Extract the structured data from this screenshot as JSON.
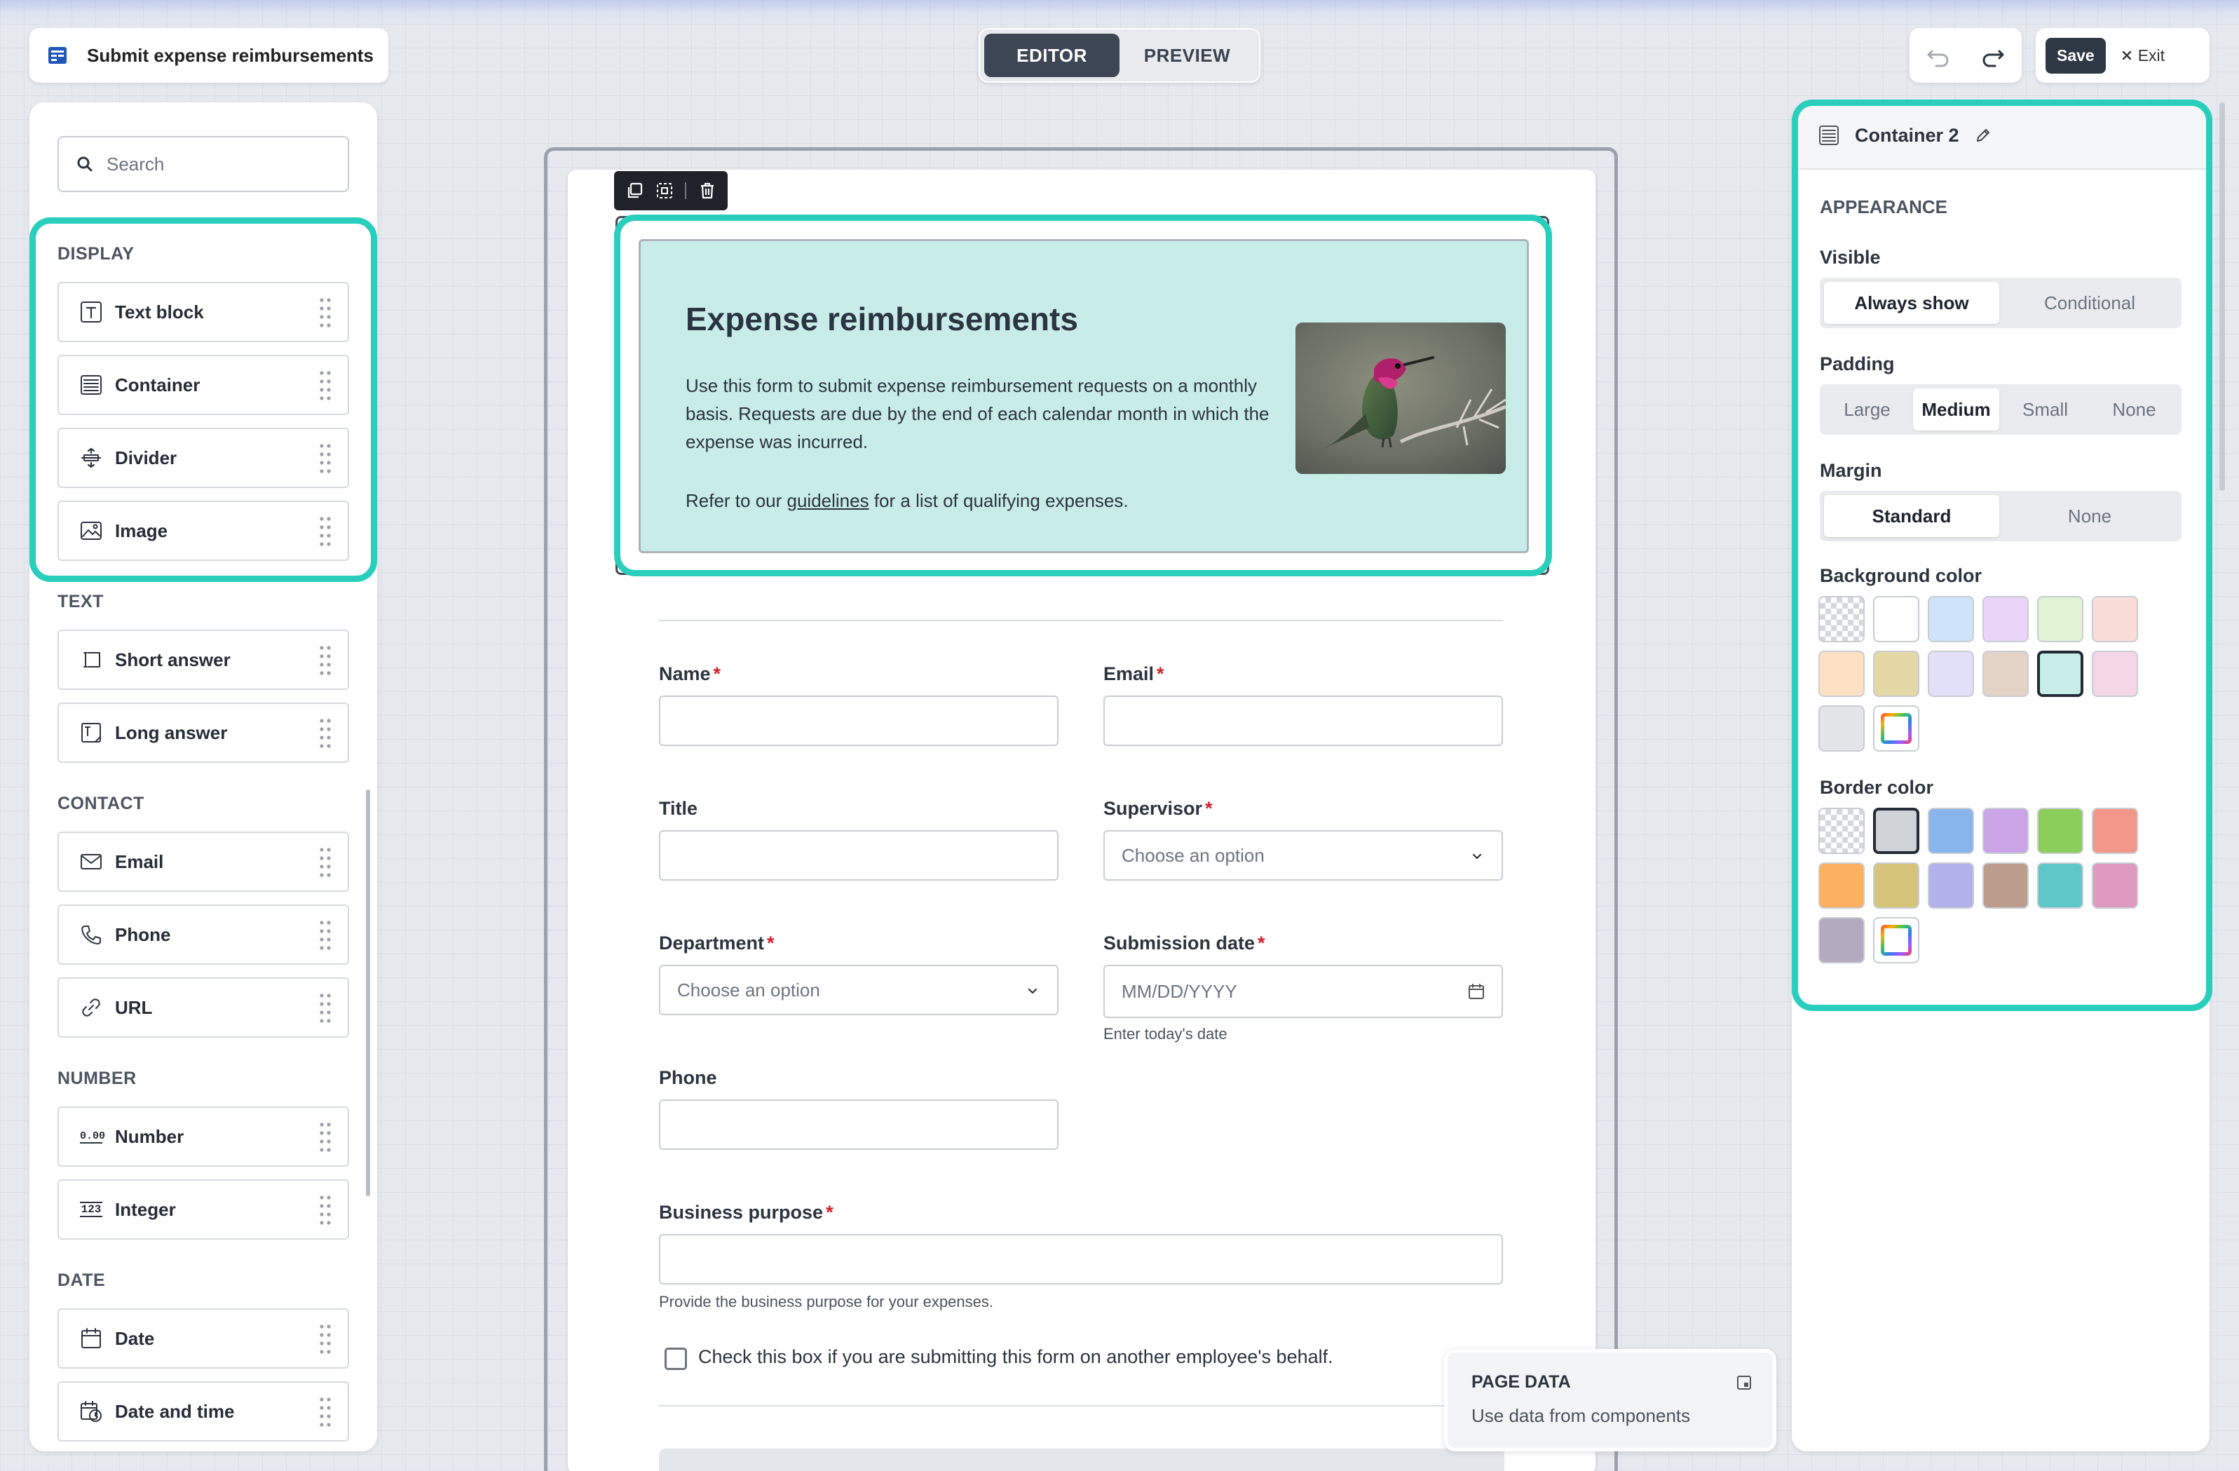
{
  "app": {
    "title": "Submit expense reimbursements"
  },
  "mode": {
    "editor": "EDITOR",
    "preview": "PREVIEW",
    "active": "editor"
  },
  "actions": {
    "save": "Save",
    "exit": "Exit"
  },
  "search": {
    "placeholder": "Search"
  },
  "palette": {
    "sections": [
      {
        "title": "DISPLAY",
        "items": [
          {
            "label": "Text block",
            "icon": "text-block-icon"
          },
          {
            "label": "Container",
            "icon": "container-icon"
          },
          {
            "label": "Divider",
            "icon": "divider-icon"
          },
          {
            "label": "Image",
            "icon": "image-icon"
          }
        ]
      },
      {
        "title": "TEXT",
        "items": [
          {
            "label": "Short answer",
            "icon": "short-answer-icon"
          },
          {
            "label": "Long answer",
            "icon": "long-answer-icon"
          }
        ]
      },
      {
        "title": "CONTACT",
        "items": [
          {
            "label": "Email",
            "icon": "mail-icon"
          },
          {
            "label": "Phone",
            "icon": "phone-icon"
          },
          {
            "label": "URL",
            "icon": "link-icon"
          }
        ]
      },
      {
        "title": "NUMBER",
        "items": [
          {
            "label": "Number",
            "icon": "number-icon",
            "glyph": "0.00"
          },
          {
            "label": "Integer",
            "icon": "integer-icon",
            "glyph": "123"
          }
        ]
      },
      {
        "title": "DATE",
        "items": [
          {
            "label": "Date",
            "icon": "calendar-icon"
          },
          {
            "label": "Date and time",
            "icon": "date-time-icon"
          }
        ]
      }
    ]
  },
  "form": {
    "hero": {
      "title": "Expense reimbursements",
      "body": "Use this form to submit expense reimbursement requests on a monthly basis. Requests are due by the end of each calendar month in which the expense was incurred.",
      "refer_before": "Refer to our ",
      "refer_link": "guidelines",
      "refer_after": " for a list of qualifying expenses."
    },
    "fields": {
      "name": {
        "label": "Name",
        "required": "*"
      },
      "email": {
        "label": "Email",
        "required": "*"
      },
      "title": {
        "label": "Title"
      },
      "supervisor": {
        "label": "Supervisor",
        "required": "*",
        "placeholder": "Choose an option"
      },
      "department": {
        "label": "Department",
        "required": "*",
        "placeholder": "Choose an option"
      },
      "submission_date": {
        "label": "Submission date",
        "required": "*",
        "placeholder": "MM/DD/YYYY",
        "help": "Enter today's date"
      },
      "phone": {
        "label": "Phone"
      },
      "business_purpose": {
        "label": "Business purpose",
        "required": "*",
        "help": "Provide the business purpose for your expenses."
      }
    },
    "checkbox": {
      "label": "Check this box if you are submitting this form on another employee's behalf.",
      "checked": false
    }
  },
  "page_data": {
    "title": "PAGE DATA",
    "subtitle": "Use data from components"
  },
  "inspector": {
    "title": "Container 2",
    "section": "APPEARANCE",
    "visible": {
      "label": "Visible",
      "options": [
        "Always show",
        "Conditional"
      ],
      "selected": "Always show"
    },
    "padding": {
      "label": "Padding",
      "options": [
        "Large",
        "Medium",
        "Small",
        "None"
      ],
      "selected": "Medium"
    },
    "margin": {
      "label": "Margin",
      "options": [
        "Standard",
        "None"
      ],
      "selected": "Standard"
    },
    "background_color": {
      "label": "Background color",
      "swatches": [
        "transparent",
        "#ffffff",
        "#cfe3fa",
        "#ead4f7",
        "#e1f3d4",
        "#fbddd8",
        "#fde1c2",
        "#e5d8a7",
        "#e2e0f9",
        "#e3d4c7",
        "#c8ece8",
        "#f3d7e6",
        "#e4e5e8",
        "custom"
      ],
      "selected_index": 10
    },
    "border_color": {
      "label": "Border color",
      "swatches": [
        "transparent",
        "#cfd3d8",
        "#87b5ec",
        "#c9a4e6",
        "#8cce5c",
        "#f3978a",
        "#fbb160",
        "#d6c47a",
        "#b3b1ec",
        "#bc9d8c",
        "#5ec8c8",
        "#df9ac0",
        "#b4aabf",
        "custom"
      ],
      "selected_index": 1
    }
  },
  "colors": {
    "accent_highlight": "#29cfbc",
    "dark": "#2f3845",
    "hero_bg": "#c8ece8"
  }
}
